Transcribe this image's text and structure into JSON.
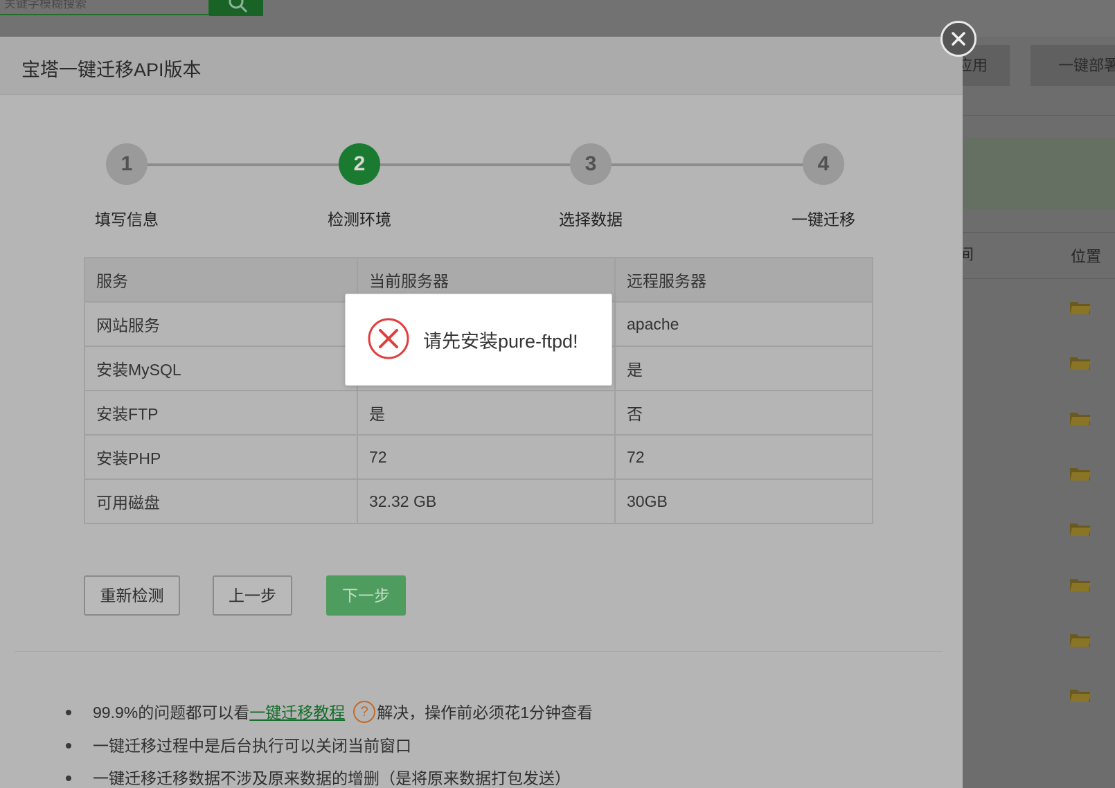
{
  "background": {
    "search_placeholder": "关键字模糊搜索",
    "button_partial_1": "应用",
    "button_partial_2": "一键部署",
    "table_header_partial": "间",
    "table_header_position": "位置",
    "folder_icon": "folder-icon"
  },
  "modal": {
    "title": "宝塔一键迁移API版本",
    "close_icon": "close-icon"
  },
  "stepper": {
    "steps": [
      {
        "number": "1",
        "label": "填写信息"
      },
      {
        "number": "2",
        "label": "检测环境"
      },
      {
        "number": "3",
        "label": "选择数据"
      },
      {
        "number": "4",
        "label": "一键迁移"
      }
    ],
    "active_step": 2
  },
  "env_table": {
    "headers": [
      "服务",
      "当前服务器",
      "远程服务器"
    ],
    "rows": [
      [
        "网站服务",
        "",
        "apache"
      ],
      [
        "安装MySQL",
        "",
        "是"
      ],
      [
        "安装FTP",
        "是",
        "否"
      ],
      [
        "安装PHP",
        "72",
        "72"
      ],
      [
        "可用磁盘",
        "32.32 GB",
        "30GB"
      ]
    ]
  },
  "buttons": {
    "recheck": "重新检测",
    "prev": "上一步",
    "next": "下一步"
  },
  "notes": {
    "n1_prefix": "99.9%的问题都可以看",
    "n1_link": "一键迁移教程",
    "n1_help": "?",
    "n1_suffix": "解决，操作前必须花1分钟查看",
    "n2": "一键迁移过程中是后台执行可以关闭当前窗口",
    "n3": "一键迁移迁移数据不涉及原来数据的增删（是将原来数据打包发送）"
  },
  "toast": {
    "icon": "error-icon",
    "message": "请先安装pure-ftpd!"
  },
  "colors": {
    "active_step": "#1a7a30",
    "next_button": "#4f9d5e",
    "error": "#e03d3d",
    "link": "#156e2a",
    "help": "#c26a2b"
  }
}
